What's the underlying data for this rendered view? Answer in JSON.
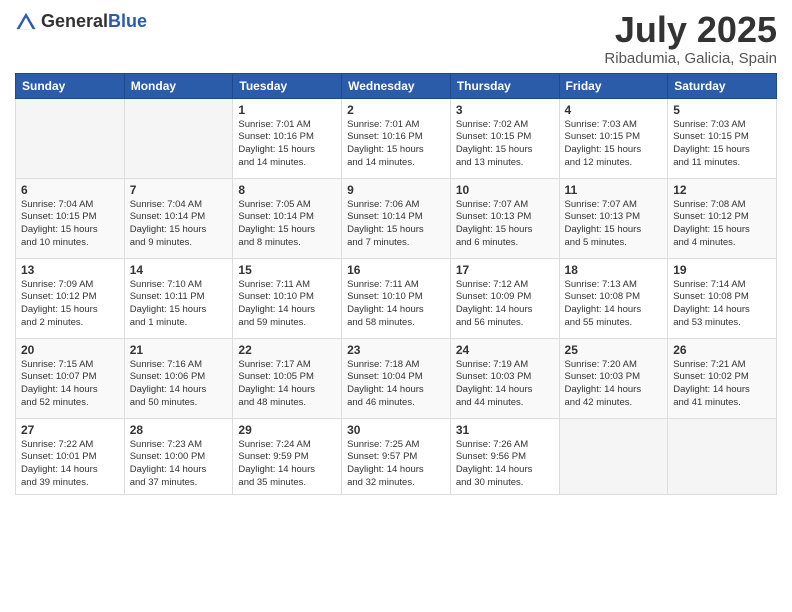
{
  "header": {
    "logo_general": "General",
    "logo_blue": "Blue",
    "month": "July 2025",
    "location": "Ribadumia, Galicia, Spain"
  },
  "days_of_week": [
    "Sunday",
    "Monday",
    "Tuesday",
    "Wednesday",
    "Thursday",
    "Friday",
    "Saturday"
  ],
  "weeks": [
    [
      {
        "day": "",
        "info": ""
      },
      {
        "day": "",
        "info": ""
      },
      {
        "day": "1",
        "info": "Sunrise: 7:01 AM\nSunset: 10:16 PM\nDaylight: 15 hours\nand 14 minutes."
      },
      {
        "day": "2",
        "info": "Sunrise: 7:01 AM\nSunset: 10:16 PM\nDaylight: 15 hours\nand 14 minutes."
      },
      {
        "day": "3",
        "info": "Sunrise: 7:02 AM\nSunset: 10:15 PM\nDaylight: 15 hours\nand 13 minutes."
      },
      {
        "day": "4",
        "info": "Sunrise: 7:03 AM\nSunset: 10:15 PM\nDaylight: 15 hours\nand 12 minutes."
      },
      {
        "day": "5",
        "info": "Sunrise: 7:03 AM\nSunset: 10:15 PM\nDaylight: 15 hours\nand 11 minutes."
      }
    ],
    [
      {
        "day": "6",
        "info": "Sunrise: 7:04 AM\nSunset: 10:15 PM\nDaylight: 15 hours\nand 10 minutes."
      },
      {
        "day": "7",
        "info": "Sunrise: 7:04 AM\nSunset: 10:14 PM\nDaylight: 15 hours\nand 9 minutes."
      },
      {
        "day": "8",
        "info": "Sunrise: 7:05 AM\nSunset: 10:14 PM\nDaylight: 15 hours\nand 8 minutes."
      },
      {
        "day": "9",
        "info": "Sunrise: 7:06 AM\nSunset: 10:14 PM\nDaylight: 15 hours\nand 7 minutes."
      },
      {
        "day": "10",
        "info": "Sunrise: 7:07 AM\nSunset: 10:13 PM\nDaylight: 15 hours\nand 6 minutes."
      },
      {
        "day": "11",
        "info": "Sunrise: 7:07 AM\nSunset: 10:13 PM\nDaylight: 15 hours\nand 5 minutes."
      },
      {
        "day": "12",
        "info": "Sunrise: 7:08 AM\nSunset: 10:12 PM\nDaylight: 15 hours\nand 4 minutes."
      }
    ],
    [
      {
        "day": "13",
        "info": "Sunrise: 7:09 AM\nSunset: 10:12 PM\nDaylight: 15 hours\nand 2 minutes."
      },
      {
        "day": "14",
        "info": "Sunrise: 7:10 AM\nSunset: 10:11 PM\nDaylight: 15 hours\nand 1 minute."
      },
      {
        "day": "15",
        "info": "Sunrise: 7:11 AM\nSunset: 10:10 PM\nDaylight: 14 hours\nand 59 minutes."
      },
      {
        "day": "16",
        "info": "Sunrise: 7:11 AM\nSunset: 10:10 PM\nDaylight: 14 hours\nand 58 minutes."
      },
      {
        "day": "17",
        "info": "Sunrise: 7:12 AM\nSunset: 10:09 PM\nDaylight: 14 hours\nand 56 minutes."
      },
      {
        "day": "18",
        "info": "Sunrise: 7:13 AM\nSunset: 10:08 PM\nDaylight: 14 hours\nand 55 minutes."
      },
      {
        "day": "19",
        "info": "Sunrise: 7:14 AM\nSunset: 10:08 PM\nDaylight: 14 hours\nand 53 minutes."
      }
    ],
    [
      {
        "day": "20",
        "info": "Sunrise: 7:15 AM\nSunset: 10:07 PM\nDaylight: 14 hours\nand 52 minutes."
      },
      {
        "day": "21",
        "info": "Sunrise: 7:16 AM\nSunset: 10:06 PM\nDaylight: 14 hours\nand 50 minutes."
      },
      {
        "day": "22",
        "info": "Sunrise: 7:17 AM\nSunset: 10:05 PM\nDaylight: 14 hours\nand 48 minutes."
      },
      {
        "day": "23",
        "info": "Sunrise: 7:18 AM\nSunset: 10:04 PM\nDaylight: 14 hours\nand 46 minutes."
      },
      {
        "day": "24",
        "info": "Sunrise: 7:19 AM\nSunset: 10:03 PM\nDaylight: 14 hours\nand 44 minutes."
      },
      {
        "day": "25",
        "info": "Sunrise: 7:20 AM\nSunset: 10:03 PM\nDaylight: 14 hours\nand 42 minutes."
      },
      {
        "day": "26",
        "info": "Sunrise: 7:21 AM\nSunset: 10:02 PM\nDaylight: 14 hours\nand 41 minutes."
      }
    ],
    [
      {
        "day": "27",
        "info": "Sunrise: 7:22 AM\nSunset: 10:01 PM\nDaylight: 14 hours\nand 39 minutes."
      },
      {
        "day": "28",
        "info": "Sunrise: 7:23 AM\nSunset: 10:00 PM\nDaylight: 14 hours\nand 37 minutes."
      },
      {
        "day": "29",
        "info": "Sunrise: 7:24 AM\nSunset: 9:59 PM\nDaylight: 14 hours\nand 35 minutes."
      },
      {
        "day": "30",
        "info": "Sunrise: 7:25 AM\nSunset: 9:57 PM\nDaylight: 14 hours\nand 32 minutes."
      },
      {
        "day": "31",
        "info": "Sunrise: 7:26 AM\nSunset: 9:56 PM\nDaylight: 14 hours\nand 30 minutes."
      },
      {
        "day": "",
        "info": ""
      },
      {
        "day": "",
        "info": ""
      }
    ]
  ]
}
